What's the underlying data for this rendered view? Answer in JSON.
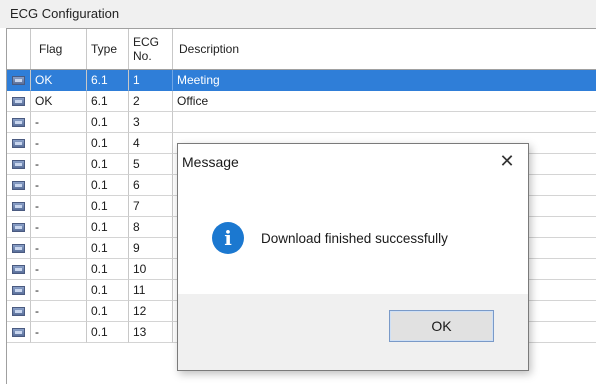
{
  "panel": {
    "title": "ECG Configuration"
  },
  "columns": {
    "flag": "Flag",
    "type": "Type",
    "ecg_line1": "ECG",
    "ecg_line2": "No.",
    "description": "Description"
  },
  "rows": [
    {
      "flag": "OK",
      "type": "6.1",
      "ecg": "1",
      "description": "Meeting",
      "selected": true
    },
    {
      "flag": "OK",
      "type": "6.1",
      "ecg": "2",
      "description": "Office"
    },
    {
      "flag": "-",
      "type": "0.1",
      "ecg": "3",
      "description": ""
    },
    {
      "flag": "-",
      "type": "0.1",
      "ecg": "4",
      "description": ""
    },
    {
      "flag": "-",
      "type": "0.1",
      "ecg": "5",
      "description": ""
    },
    {
      "flag": "-",
      "type": "0.1",
      "ecg": "6",
      "description": ""
    },
    {
      "flag": "-",
      "type": "0.1",
      "ecg": "7",
      "description": ""
    },
    {
      "flag": "-",
      "type": "0.1",
      "ecg": "8",
      "description": ""
    },
    {
      "flag": "-",
      "type": "0.1",
      "ecg": "9",
      "description": ""
    },
    {
      "flag": "-",
      "type": "0.1",
      "ecg": "10",
      "description": ""
    },
    {
      "flag": "-",
      "type": "0.1",
      "ecg": "11",
      "description": ""
    },
    {
      "flag": "-",
      "type": "0.1",
      "ecg": "12",
      "description": ""
    },
    {
      "flag": "-",
      "type": "0.1",
      "ecg": "13",
      "description": ""
    }
  ],
  "dialog": {
    "title": "Message",
    "close_glyph": "✕",
    "icon": "info-icon",
    "info_glyph": "i",
    "message": "Download finished successfully",
    "ok_label": "OK"
  },
  "colors": {
    "selection": "#2f7ed8",
    "info": "#1b78d0"
  }
}
